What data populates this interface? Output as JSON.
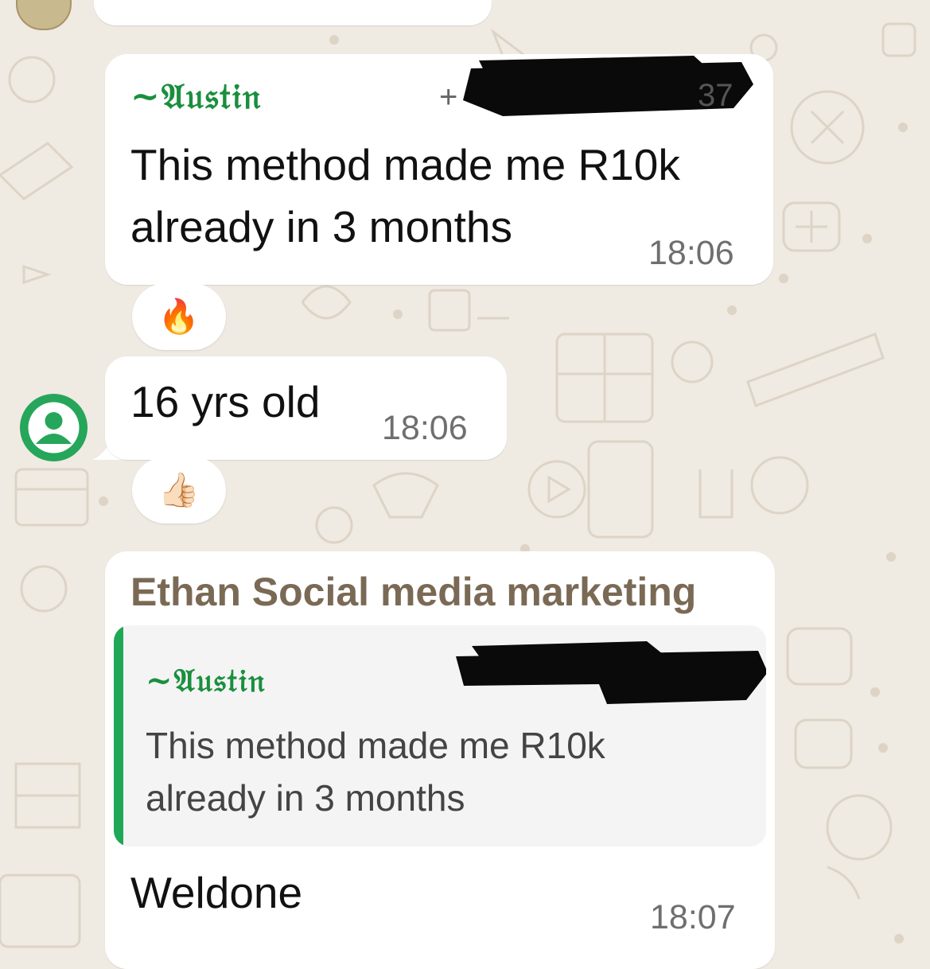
{
  "colors": {
    "wallpaper": "#efeae2",
    "bubble": "#ffffff",
    "sender_name": "#1a8f3e",
    "group_name": "#7a6a55",
    "quote_bar": "#1fa855",
    "timestamp": "#6f6f6f",
    "avatar": "#25a65a"
  },
  "messages": [
    {
      "sender": "~𝔄𝔲𝔰𝔱𝔦𝔫",
      "phone_prefix": "+",
      "phone_visible_tail": "37",
      "text_line1": "This method made me R10k",
      "text_line2": "already in 3 months",
      "time": "18:06",
      "reaction": "🔥"
    },
    {
      "text": "16 yrs old",
      "time": "18:06",
      "reaction": "👍🏻"
    },
    {
      "group_name": "Ethan Social media marketing",
      "quoted_sender": "~𝔄𝔲𝔰𝔱𝔦𝔫",
      "quoted_line1": "This method made me R10k",
      "quoted_line2": "already in 3 months",
      "text": "Weldone",
      "time": "18:07"
    }
  ]
}
